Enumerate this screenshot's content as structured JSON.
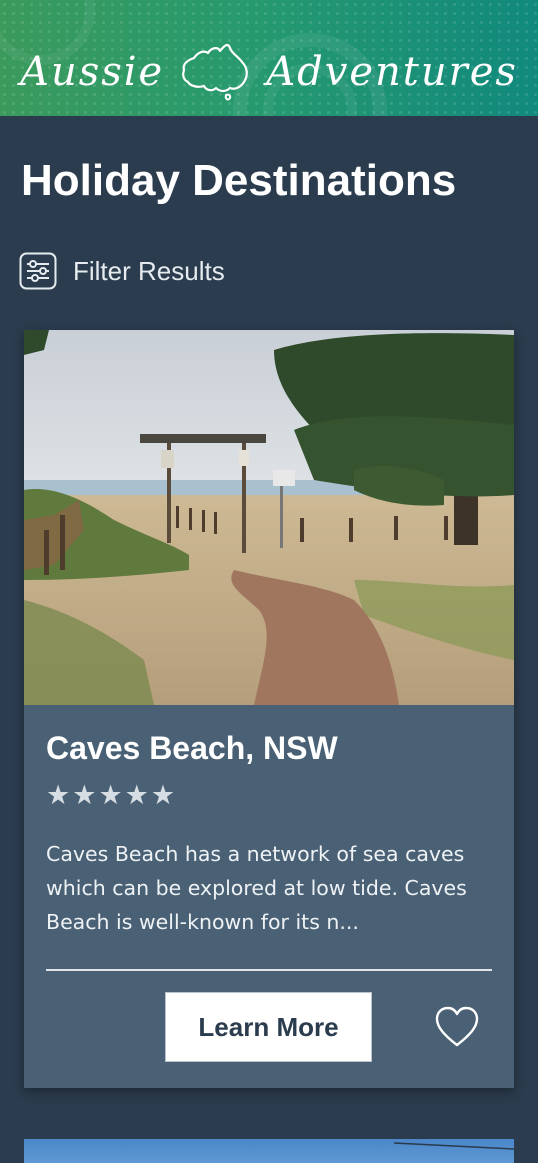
{
  "header": {
    "brand_left": "Aussie",
    "brand_right": "Adventures",
    "logo_icon": "australia-map-icon",
    "colors": {
      "start": "#3b9a5c",
      "end": "#11897d"
    }
  },
  "page": {
    "title": "Holiday Destinations",
    "background": "#2b3c4e"
  },
  "filter": {
    "label": "Filter Results",
    "icon": "sliders-icon"
  },
  "cards": [
    {
      "title": "Caves Beach, NSW",
      "rating": 5,
      "rating_max": 5,
      "description": "Caves Beach has a network of sea caves which can be explored at low tide. Caves Beach is well-known for its n...",
      "learn_more_label": "Learn More",
      "favorite_icon": "heart-outline-icon",
      "card_color": "#4a6175"
    }
  ]
}
